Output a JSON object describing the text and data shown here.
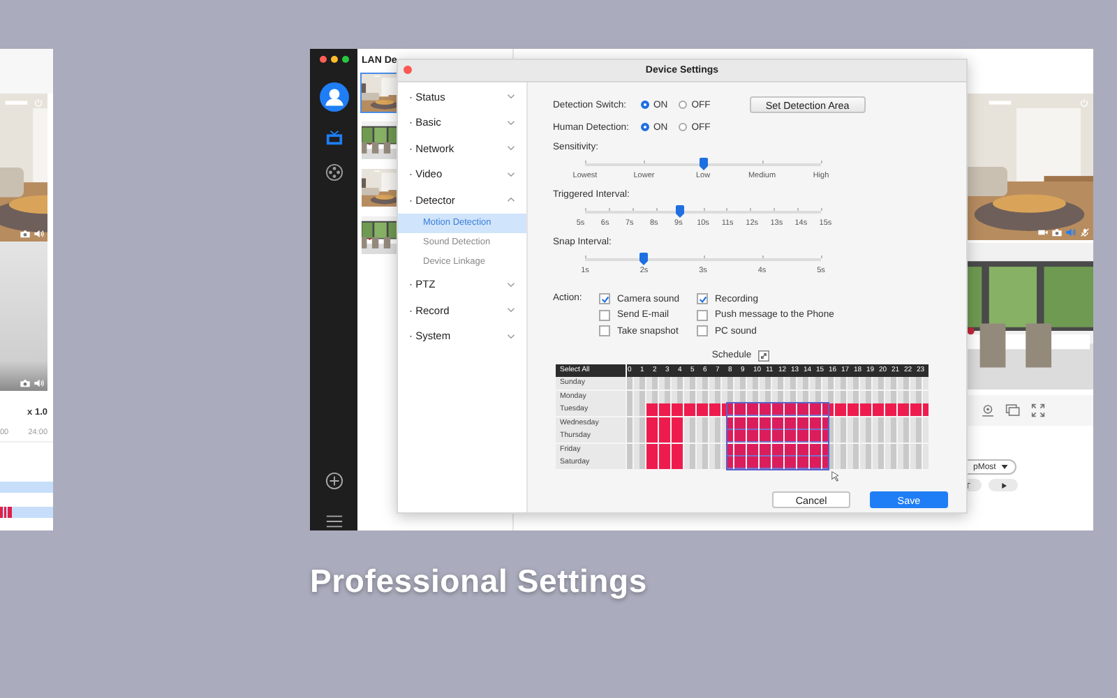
{
  "left_window": {
    "picture": {
      "kind": "picture"
    },
    "speed": "x 1.0",
    "timeline_labels": [
      "00",
      "24:00"
    ]
  },
  "main_window": {
    "sidebar": {
      "items": [
        {
          "kind": "avatar"
        },
        {
          "kind": "tv",
          "selected": true
        },
        {
          "kind": "reel",
          "selected": false
        }
      ]
    },
    "device_list": {
      "title": "LAN De",
      "devices": [
        {
          "kind": "picture"
        },
        {
          "kind": "picture"
        },
        {
          "kind": "picture"
        },
        {
          "kind": "picture"
        }
      ]
    },
    "camera_tiles": [
      {
        "kind": "picture"
      },
      {
        "kind": "picture"
      }
    ],
    "stream_select": {
      "value": "pMost"
    }
  },
  "dialog": {
    "title": "Device Settings",
    "nav": [
      {
        "label": "· Status",
        "expanded": false
      },
      {
        "label": "· Basic",
        "expanded": false
      },
      {
        "label": "· Network",
        "expanded": false
      },
      {
        "label": "· Video",
        "expanded": false
      },
      {
        "label": "· Detector",
        "expanded": true,
        "children": [
          {
            "label": "Motion Detection",
            "selected": true
          },
          {
            "label": "Sound Detection",
            "selected": false
          },
          {
            "label": "Device Linkage",
            "selected": false
          }
        ]
      },
      {
        "label": "· PTZ",
        "expanded": false
      },
      {
        "label": "· Record",
        "expanded": false
      },
      {
        "label": "· System",
        "expanded": false
      }
    ],
    "detection_switch": {
      "label": "Detection Switch:",
      "options": [
        {
          "label": "ON",
          "selected": true
        },
        {
          "label": "OFF",
          "selected": false
        }
      ]
    },
    "set_area_button": "Set Detection Area",
    "human_detection": {
      "label": "Human Detection:",
      "options": [
        {
          "label": "ON",
          "selected": true
        },
        {
          "label": "OFF",
          "selected": false
        }
      ]
    },
    "sliders": [
      {
        "label": "Sensitivity:",
        "level": 0.5,
        "ticks": [
          "Lowest",
          "Lower",
          "Low",
          "Medium",
          "High"
        ]
      },
      {
        "label": "Triggered Interval:",
        "level": 0.4,
        "ticks": [
          "5s",
          "6s",
          "7s",
          "8s",
          "9s",
          "10s",
          "11s",
          "12s",
          "13s",
          "14s",
          "15s"
        ]
      },
      {
        "label": "Snap Interval:",
        "level": 0.25,
        "ticks": [
          "1s",
          "2s",
          "3s",
          "4s",
          "5s"
        ]
      }
    ],
    "actions": {
      "label": "Action:",
      "items": [
        {
          "label": "Camera sound",
          "checked": true
        },
        {
          "label": "Recording",
          "checked": true
        },
        {
          "label": "Send E-mail",
          "checked": false
        },
        {
          "label": "Push message to the Phone",
          "checked": false
        },
        {
          "label": "Take snapshot",
          "checked": false
        },
        {
          "label": "PC sound",
          "checked": false
        }
      ]
    },
    "schedule": {
      "title": "Schedule",
      "select_all": "Select All",
      "hours": [
        "0",
        "1",
        "2",
        "3",
        "4",
        "5",
        "6",
        "7",
        "8",
        "9",
        "10",
        "11",
        "12",
        "13",
        "14",
        "15",
        "16",
        "17",
        "18",
        "19",
        "20",
        "21",
        "22",
        "23"
      ],
      "rows": [
        {
          "day": "Sunday",
          "on": [
            false,
            false,
            false,
            false,
            false,
            false,
            false,
            false,
            false,
            false,
            false,
            false,
            false,
            false,
            false,
            false,
            false,
            false,
            false,
            false,
            false,
            false,
            false,
            false,
            false,
            false,
            false,
            false,
            false,
            false,
            false,
            false,
            false,
            false,
            false,
            false,
            false,
            false,
            false,
            false,
            false,
            false,
            false,
            false,
            false,
            false,
            false,
            false
          ],
          "in_selection": [
            false,
            false,
            false,
            false,
            false,
            false,
            false,
            false,
            false,
            false,
            false,
            false,
            false,
            false,
            false,
            false,
            false,
            false,
            false,
            false,
            false,
            false,
            false,
            false,
            false,
            false,
            false,
            false,
            false,
            false,
            false,
            false,
            false,
            false,
            false,
            false,
            false,
            false,
            false,
            false,
            false,
            false,
            false,
            false,
            false,
            false,
            false,
            false
          ]
        },
        {
          "day": "Monday",
          "on": [
            false,
            false,
            false,
            false,
            false,
            false,
            false,
            false,
            false,
            false,
            false,
            false,
            false,
            false,
            false,
            false,
            false,
            false,
            false,
            false,
            false,
            false,
            false,
            false,
            false,
            false,
            false,
            false,
            false,
            false,
            false,
            false,
            false,
            false,
            false,
            false,
            false,
            false,
            false,
            false,
            false,
            false,
            false,
            false,
            false,
            false,
            false,
            false
          ],
          "in_selection": [
            false,
            false,
            false,
            false,
            false,
            false,
            false,
            false,
            false,
            false,
            false,
            false,
            false,
            false,
            false,
            false,
            false,
            false,
            false,
            false,
            false,
            false,
            false,
            false,
            false,
            false,
            false,
            false,
            false,
            false,
            false,
            false,
            false,
            false,
            false,
            false,
            false,
            false,
            false,
            false,
            false,
            false,
            false,
            false,
            false,
            false,
            false,
            false
          ]
        },
        {
          "day": "Tuesday",
          "on": [
            false,
            false,
            false,
            true,
            true,
            true,
            true,
            true,
            true,
            true,
            true,
            true,
            true,
            true,
            true,
            true,
            true,
            true,
            true,
            true,
            true,
            true,
            true,
            true,
            true,
            true,
            true,
            true,
            true,
            true,
            true,
            true,
            true,
            true,
            true,
            true,
            true,
            true,
            true,
            true,
            true,
            true,
            true,
            true,
            true,
            true,
            true,
            true
          ],
          "in_selection": [
            false,
            false,
            false,
            false,
            false,
            false,
            false,
            false,
            false,
            false,
            false,
            false,
            false,
            false,
            false,
            false,
            true,
            true,
            true,
            true,
            true,
            true,
            true,
            true,
            true,
            true,
            true,
            true,
            true,
            true,
            true,
            true,
            false,
            false,
            false,
            false,
            false,
            false,
            false,
            false,
            false,
            false,
            false,
            false,
            false,
            false,
            false,
            false
          ]
        },
        {
          "day": "Wednesday",
          "on": [
            false,
            false,
            false,
            true,
            true,
            true,
            true,
            true,
            true,
            false,
            false,
            false,
            false,
            false,
            false,
            false,
            true,
            true,
            true,
            true,
            true,
            true,
            true,
            true,
            true,
            true,
            true,
            true,
            true,
            true,
            true,
            true,
            false,
            false,
            false,
            false,
            false,
            false,
            false,
            false,
            false,
            false,
            false,
            false,
            false,
            false,
            false,
            false
          ],
          "in_selection": [
            false,
            false,
            false,
            false,
            false,
            false,
            false,
            false,
            false,
            false,
            false,
            false,
            false,
            false,
            false,
            false,
            true,
            true,
            true,
            true,
            true,
            true,
            true,
            true,
            true,
            true,
            true,
            true,
            true,
            true,
            true,
            true,
            false,
            false,
            false,
            false,
            false,
            false,
            false,
            false,
            false,
            false,
            false,
            false,
            false,
            false,
            false,
            false
          ]
        },
        {
          "day": "Thursday",
          "on": [
            false,
            false,
            false,
            true,
            true,
            true,
            true,
            true,
            true,
            false,
            false,
            false,
            false,
            false,
            false,
            false,
            true,
            true,
            true,
            true,
            true,
            true,
            true,
            true,
            true,
            true,
            true,
            true,
            true,
            true,
            true,
            true,
            false,
            false,
            false,
            false,
            false,
            false,
            false,
            false,
            false,
            false,
            false,
            false,
            false,
            false,
            false,
            false
          ],
          "in_selection": [
            false,
            false,
            false,
            false,
            false,
            false,
            false,
            false,
            false,
            false,
            false,
            false,
            false,
            false,
            false,
            false,
            true,
            true,
            true,
            true,
            true,
            true,
            true,
            true,
            true,
            true,
            true,
            true,
            true,
            true,
            true,
            true,
            false,
            false,
            false,
            false,
            false,
            false,
            false,
            false,
            false,
            false,
            false,
            false,
            false,
            false,
            false,
            false
          ]
        },
        {
          "day": "Friday",
          "on": [
            false,
            false,
            false,
            true,
            true,
            true,
            true,
            true,
            true,
            false,
            false,
            false,
            false,
            false,
            false,
            false,
            true,
            true,
            true,
            true,
            true,
            true,
            true,
            true,
            true,
            true,
            true,
            true,
            true,
            true,
            true,
            true,
            false,
            false,
            false,
            false,
            false,
            false,
            false,
            false,
            false,
            false,
            false,
            false,
            false,
            false,
            false,
            false
          ],
          "in_selection": [
            false,
            false,
            false,
            false,
            false,
            false,
            false,
            false,
            false,
            false,
            false,
            false,
            false,
            false,
            false,
            false,
            true,
            true,
            true,
            true,
            true,
            true,
            true,
            true,
            true,
            true,
            true,
            true,
            true,
            true,
            true,
            true,
            false,
            false,
            false,
            false,
            false,
            false,
            false,
            false,
            false,
            false,
            false,
            false,
            false,
            false,
            false,
            false
          ]
        },
        {
          "day": "Saturday",
          "on": [
            false,
            false,
            false,
            true,
            true,
            true,
            true,
            true,
            true,
            false,
            false,
            false,
            false,
            false,
            false,
            false,
            true,
            true,
            true,
            true,
            true,
            true,
            true,
            true,
            true,
            true,
            true,
            true,
            true,
            true,
            true,
            true,
            false,
            false,
            false,
            false,
            false,
            false,
            false,
            false,
            false,
            false,
            false,
            false,
            false,
            false,
            false,
            false
          ],
          "in_selection": [
            false,
            false,
            false,
            false,
            false,
            false,
            false,
            false,
            false,
            false,
            false,
            false,
            false,
            false,
            false,
            false,
            true,
            true,
            true,
            true,
            true,
            true,
            true,
            true,
            true,
            true,
            true,
            true,
            true,
            true,
            true,
            true,
            false,
            false,
            false,
            false,
            false,
            false,
            false,
            false,
            false,
            false,
            false,
            false,
            false,
            false,
            false,
            false
          ]
        }
      ]
    },
    "buttons": [
      {
        "label": "Cancel",
        "kind": "secondary"
      },
      {
        "label": "Save",
        "kind": "primary"
      }
    ]
  },
  "caption": "Professional Settings"
}
